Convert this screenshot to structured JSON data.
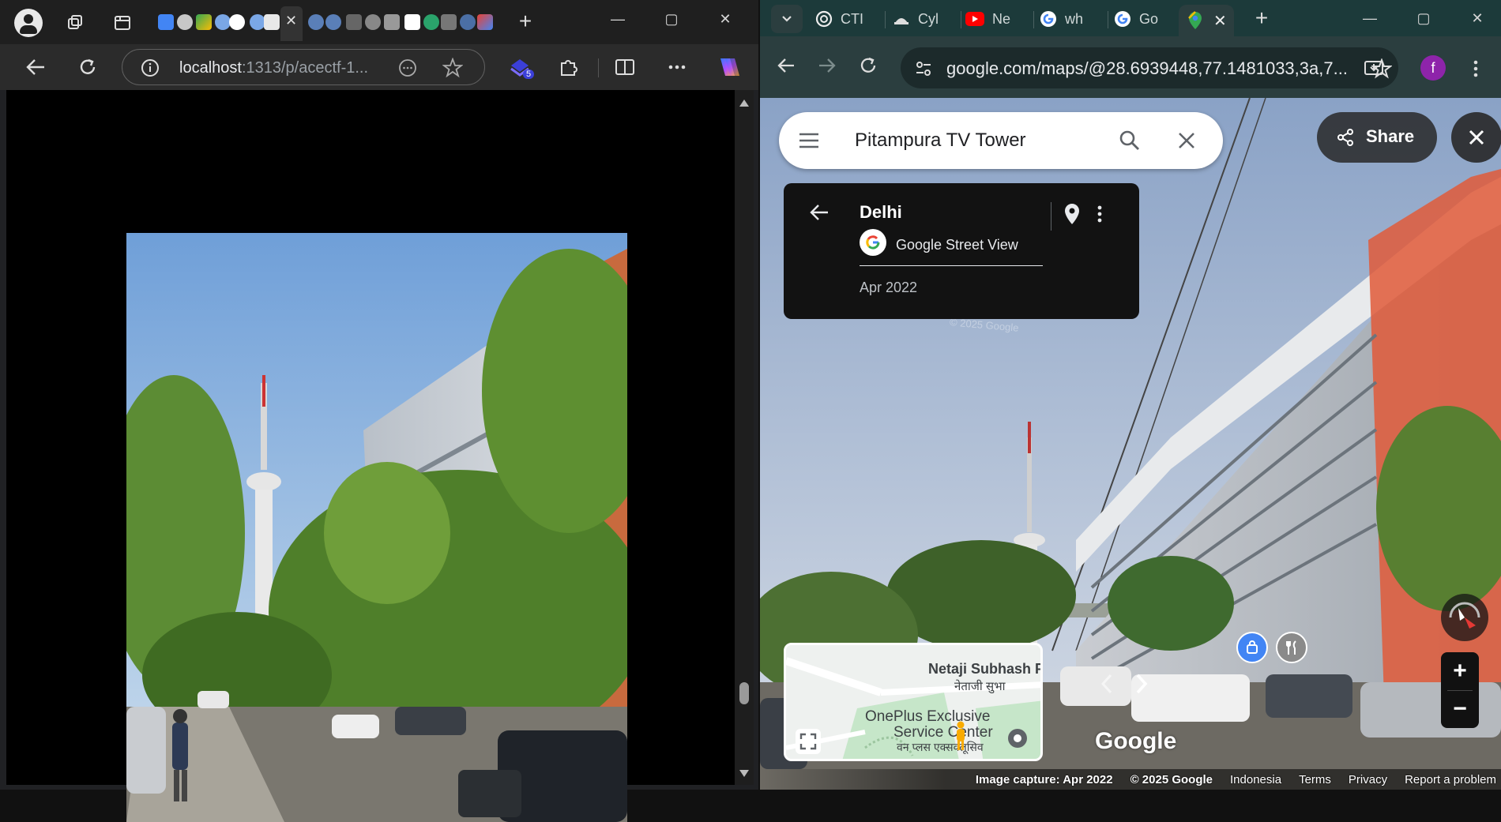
{
  "left_window": {
    "tab_close_glyph": "✕",
    "new_tab_glyph": "+",
    "window_controls": {
      "minimize": "—",
      "maximize": "▢",
      "close": "✕"
    },
    "url_host": "localhost",
    "url_rest": ":1313/p/acectf-1...",
    "extension_badge": "5",
    "scroll_up_glyph": "▲",
    "scroll_down_glyph": "▼"
  },
  "right_window": {
    "tabs": [
      {
        "label": "CTI",
        "icon": "openai-icon"
      },
      {
        "label": "Cyl",
        "icon": "hat-icon"
      },
      {
        "label": "Ne",
        "icon": "youtube-icon"
      },
      {
        "label": "wh",
        "icon": "google-icon"
      },
      {
        "label": "Go",
        "icon": "google-icon"
      }
    ],
    "active_tab_close": "✕",
    "new_tab_glyph": "+",
    "window_controls": {
      "minimize": "—",
      "maximize": "▢",
      "close": "✕"
    },
    "url": "google.com/maps/@28.6939448,77.1481033,3a,7...",
    "profile_initial": "f"
  },
  "maps": {
    "search_value": "Pitampura TV Tower",
    "share_label": "Share",
    "info_card": {
      "title": "Delhi",
      "subtitle": "Google Street View",
      "date": "Apr 2022"
    },
    "minimap": {
      "label1": "Netaji Subhash P",
      "label1b": "नेताजी सुभा",
      "label2": "OnePlus Exclusive",
      "label3": "Service Center",
      "label4": "वन प्लस एक्सक्लूसिव"
    },
    "google_logo": "Google",
    "footer": {
      "capture": "Image capture: Apr 2022",
      "copyright": "© 2025 Google",
      "country": "Indonesia",
      "terms": "Terms",
      "privacy": "Privacy",
      "report": "Report a problem"
    },
    "zoom_in": "+",
    "zoom_out": "−",
    "watermark": "© 2025 Google"
  }
}
